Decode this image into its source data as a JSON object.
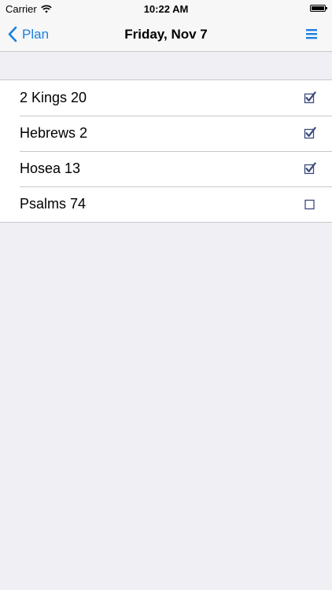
{
  "status_bar": {
    "carrier": "Carrier",
    "time": "10:22 AM"
  },
  "nav": {
    "back_label": "Plan",
    "title": "Friday, Nov 7",
    "menu_icon": "hamburger-menu-icon"
  },
  "readings": [
    {
      "label": "2 Kings 20",
      "checked": true
    },
    {
      "label": "Hebrews 2",
      "checked": true
    },
    {
      "label": "Hosea 13",
      "checked": true
    },
    {
      "label": "Psalms 74",
      "checked": false
    }
  ],
  "colors": {
    "accent": "#1a7fe0",
    "background": "#efeff4",
    "checkbox": "#3a4a7a"
  }
}
